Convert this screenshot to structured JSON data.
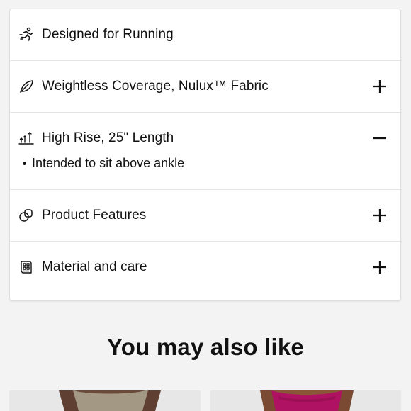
{
  "accordion": {
    "items": [
      {
        "label": "Designed for Running",
        "icon": "runner-icon",
        "toggle": "none"
      },
      {
        "label": "Weightless Coverage, Nulux™ Fabric",
        "icon": "leaf-icon",
        "toggle": "plus"
      },
      {
        "label": "High Rise, 25\" Length",
        "icon": "rise-length-icon",
        "toggle": "minus",
        "details": [
          "Intended to sit above ankle"
        ]
      },
      {
        "label": "Product Features",
        "icon": "features-icon",
        "toggle": "plus"
      },
      {
        "label": "Material and care",
        "icon": "care-label-icon",
        "toggle": "plus"
      }
    ]
  },
  "recommendations": {
    "title": "You may also like",
    "cards": [
      {
        "name": "product-card-1",
        "image_colors": [
          "#e7e7e7",
          "#a39884",
          "#6b4a3a"
        ]
      },
      {
        "name": "product-card-2",
        "image_colors": [
          "#e7e7e7",
          "#b01263",
          "#8a5638"
        ]
      }
    ]
  },
  "colors": {
    "text": "#111111",
    "page_bg": "#f3f3f3",
    "panel_bg": "#ffffff",
    "divider": "#e3e3e3"
  }
}
